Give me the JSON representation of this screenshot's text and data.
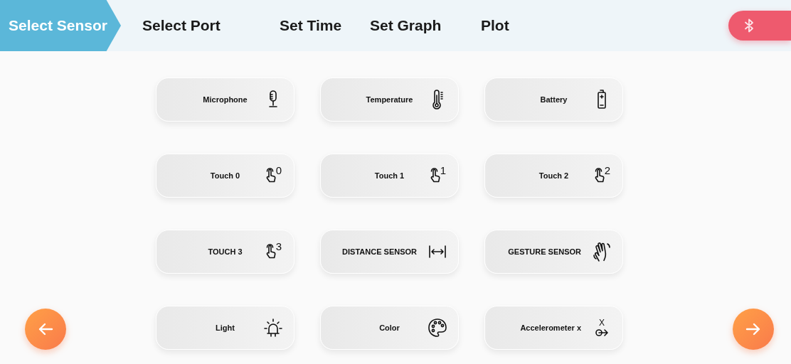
{
  "steps": [
    {
      "label": "Select Sensor",
      "selected": true
    },
    {
      "label": "Select Port",
      "selected": false
    },
    {
      "label": "Set Time",
      "selected": false
    },
    {
      "label": "Set Graph",
      "selected": false
    },
    {
      "label": "Plot",
      "selected": false
    }
  ],
  "sensors": [
    {
      "label": "Microphone",
      "kind": "mic"
    },
    {
      "label": "Temperature",
      "kind": "thermo"
    },
    {
      "label": "Battery",
      "kind": "battery"
    },
    {
      "label": "Touch 0",
      "kind": "touch",
      "icon_text": "0"
    },
    {
      "label": "Touch 1",
      "kind": "touch",
      "icon_text": "1"
    },
    {
      "label": "Touch 2",
      "kind": "touch",
      "icon_text": "2"
    },
    {
      "label": "TOUCH 3",
      "kind": "touch",
      "icon_text": "3"
    },
    {
      "label": "DISTANCE SENSOR",
      "kind": "distance"
    },
    {
      "label": "GESTURE SENSOR",
      "kind": "gesture"
    },
    {
      "label": "Light",
      "kind": "light"
    },
    {
      "label": "Color",
      "kind": "palette"
    },
    {
      "label": "Accelerometer x",
      "kind": "accel",
      "icon_text": "X"
    }
  ]
}
